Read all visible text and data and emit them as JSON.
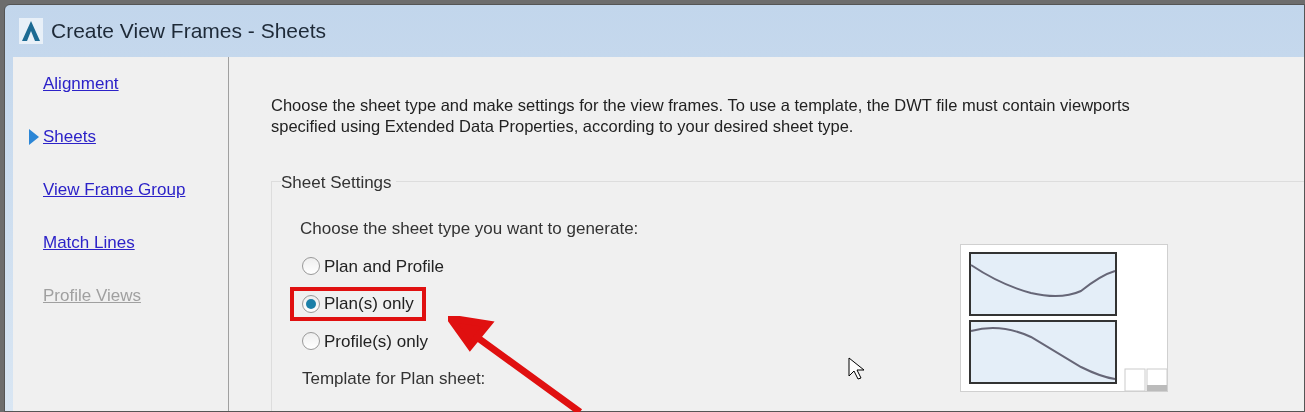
{
  "window": {
    "title": "Create View Frames - Sheets"
  },
  "nav": [
    {
      "label": "Alignment",
      "selected": false,
      "disabled": false
    },
    {
      "label": "Sheets",
      "selected": true,
      "disabled": false
    },
    {
      "label": "View Frame Group",
      "selected": false,
      "disabled": false
    },
    {
      "label": "Match Lines",
      "selected": false,
      "disabled": false
    },
    {
      "label": "Profile Views",
      "selected": false,
      "disabled": true
    }
  ],
  "description": "Choose the sheet type and make settings for the view frames. To use a template, the DWT file must contain viewports specified using Extended Data Properties, according to your desired sheet type.",
  "sheet_settings": {
    "title": "Sheet Settings",
    "prompt": "Choose the sheet type you want to generate:",
    "options": [
      {
        "label": "Plan and Profile",
        "selected": false,
        "highlighted": false
      },
      {
        "label": "Plan(s) only",
        "selected": true,
        "highlighted": true
      },
      {
        "label": "Profile(s) only",
        "selected": false,
        "highlighted": false
      }
    ],
    "template_label": "Template for Plan sheet:"
  }
}
